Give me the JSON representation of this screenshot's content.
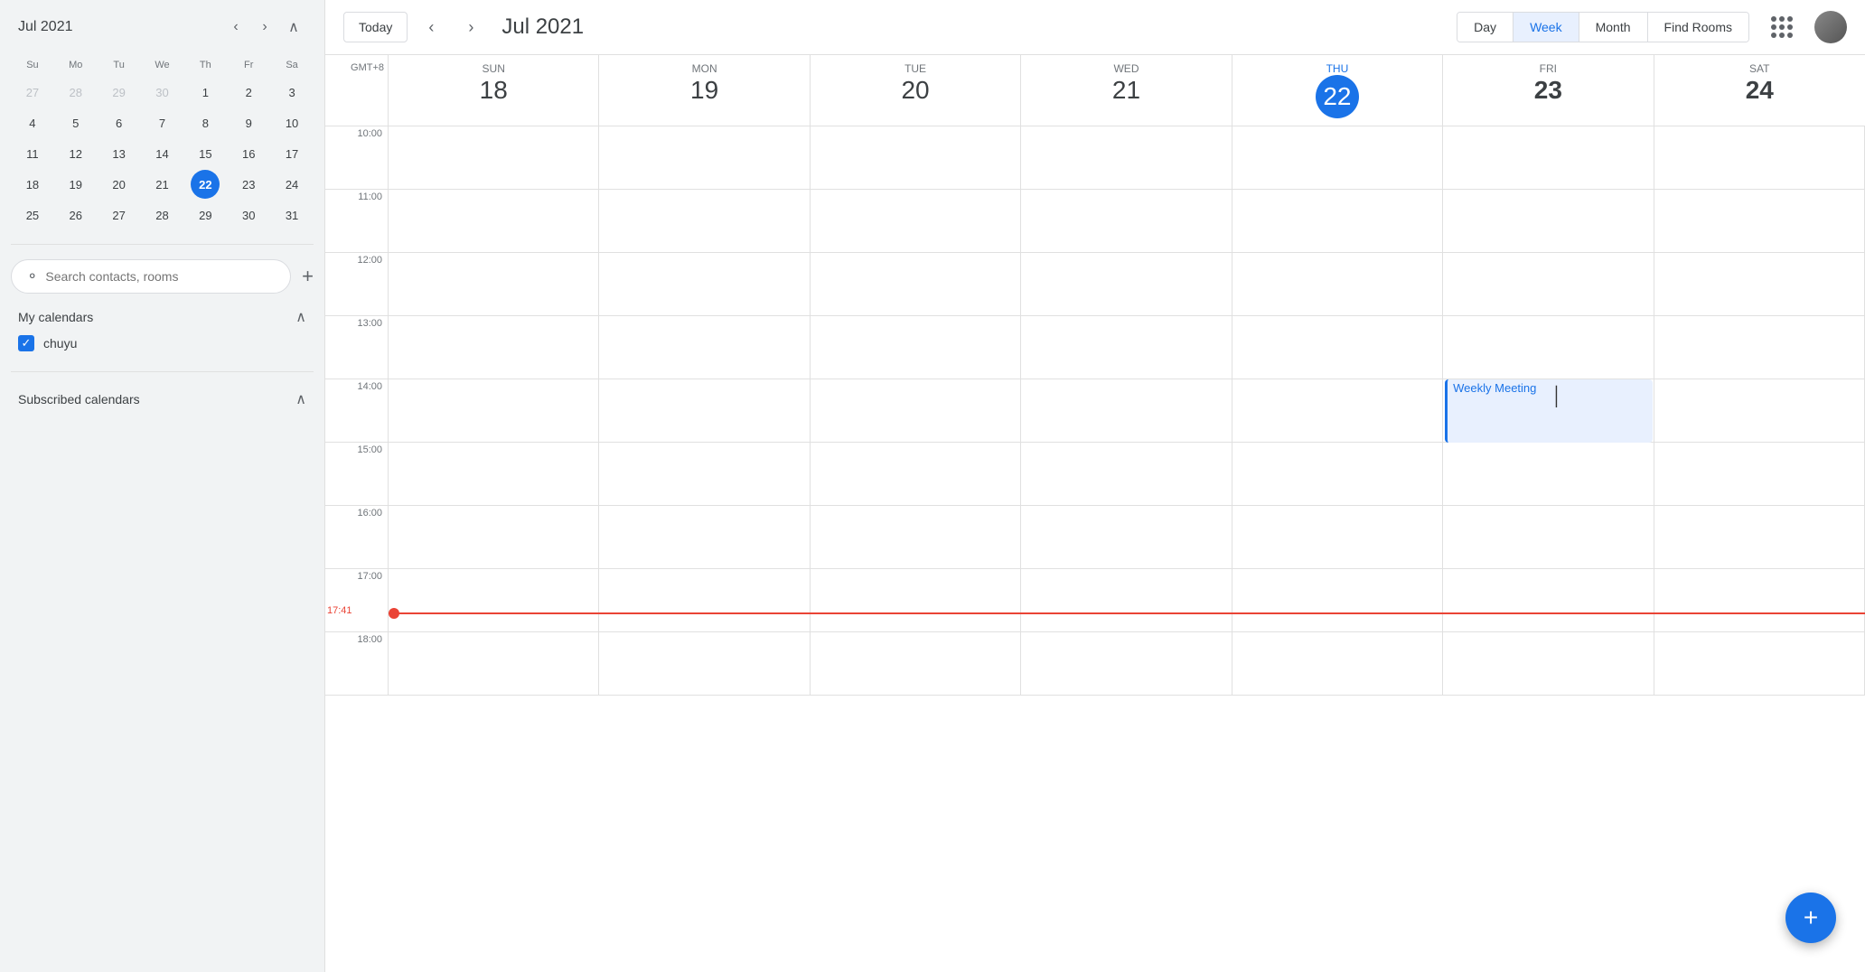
{
  "sidebar": {
    "mini_cal_title": "Jul 2021",
    "prev_label": "‹",
    "next_label": "›",
    "collapse_label": "∧",
    "day_headers": [
      "Su",
      "Mo",
      "Tu",
      "We",
      "Th",
      "Fr",
      "Sa"
    ],
    "weeks": [
      [
        {
          "n": "27",
          "other": true
        },
        {
          "n": "28",
          "other": true
        },
        {
          "n": "29",
          "other": true
        },
        {
          "n": "30",
          "other": true
        },
        {
          "n": "1"
        },
        {
          "n": "2"
        },
        {
          "n": "3"
        }
      ],
      [
        {
          "n": "4"
        },
        {
          "n": "5"
        },
        {
          "n": "6"
        },
        {
          "n": "7"
        },
        {
          "n": "8"
        },
        {
          "n": "9"
        },
        {
          "n": "10"
        }
      ],
      [
        {
          "n": "11"
        },
        {
          "n": "12"
        },
        {
          "n": "13"
        },
        {
          "n": "14"
        },
        {
          "n": "15"
        },
        {
          "n": "16"
        },
        {
          "n": "17"
        }
      ],
      [
        {
          "n": "18"
        },
        {
          "n": "19"
        },
        {
          "n": "20"
        },
        {
          "n": "21"
        },
        {
          "n": "22",
          "today": true
        },
        {
          "n": "23"
        },
        {
          "n": "24"
        }
      ],
      [
        {
          "n": "25"
        },
        {
          "n": "26"
        },
        {
          "n": "27"
        },
        {
          "n": "28"
        },
        {
          "n": "29"
        },
        {
          "n": "30"
        },
        {
          "n": "31"
        }
      ]
    ],
    "search_placeholder": "Search contacts, rooms",
    "my_calendars_label": "My calendars",
    "subscribed_calendars_label": "Subscribed calendars",
    "chuyu_label": "chuyu"
  },
  "toolbar": {
    "today_label": "Today",
    "title": "Jul 2021",
    "day_label": "Day",
    "week_label": "Week",
    "month_label": "Month",
    "find_rooms_label": "Find Rooms"
  },
  "week_header": {
    "gmt_label": "GMT+8",
    "days": [
      {
        "name": "Sun",
        "num": "18",
        "today": false
      },
      {
        "name": "Mon",
        "num": "19",
        "today": false
      },
      {
        "name": "Tue",
        "num": "20",
        "today": false
      },
      {
        "name": "Wed",
        "num": "21",
        "today": false
      },
      {
        "name": "Thu",
        "num": "22",
        "today": true
      },
      {
        "name": "Fri",
        "num": "23",
        "today": false
      },
      {
        "name": "Sat",
        "num": "24",
        "today": false
      }
    ]
  },
  "time_slots": [
    "10:00",
    "11:00",
    "12:00",
    "13:00",
    "14:00",
    "15:00",
    "16:00",
    "17:00",
    "18:00"
  ],
  "current_time": "17:41",
  "event": {
    "label": "Weekly Meeting",
    "col": 5,
    "time_offset_hours": 4.68
  },
  "fab_label": "+",
  "colors": {
    "accent": "#1a73e8",
    "today_bg": "#1a73e8",
    "event_bg": "#e8f0fe",
    "time_line": "#ea4335"
  }
}
